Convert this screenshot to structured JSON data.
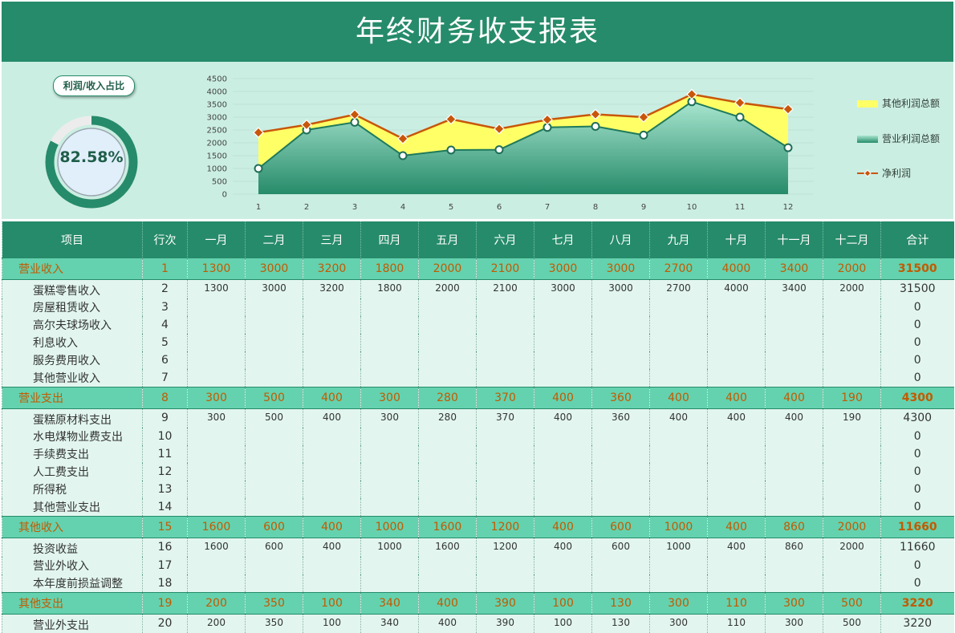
{
  "page": {
    "title": "年终财务收支报表"
  },
  "kpi": {
    "label": "利润/收入占比",
    "value": "82.58%",
    "ratio": 0.8258,
    "ring_color": "#268b6a"
  },
  "chart_data": {
    "type": "area",
    "x": [
      1,
      2,
      3,
      4,
      5,
      6,
      7,
      8,
      9,
      10,
      11,
      12
    ],
    "ylim": [
      0,
      4500
    ],
    "yticks": [
      0,
      500,
      1000,
      1500,
      2000,
      2500,
      3000,
      3500,
      4000,
      4500
    ],
    "grid": true,
    "legend_position": "right",
    "series": [
      {
        "name": "其他利润总额",
        "kind": "area",
        "color": "#ffff66",
        "values": [
          1400,
          200,
          300,
          660,
          1200,
          810,
          300,
          470,
          700,
          290,
          560,
          1500
        ]
      },
      {
        "name": "营业利润总额",
        "kind": "area",
        "color": "#3fae86",
        "values": [
          1000,
          2500,
          2800,
          1500,
          1720,
          1730,
          2600,
          2640,
          2300,
          3600,
          3000,
          1810
        ]
      },
      {
        "name": "净利润",
        "kind": "line",
        "color": "#c8560a",
        "values": [
          2400,
          2700,
          3100,
          2160,
          2920,
          2540,
          2900,
          3110,
          3000,
          3890,
          3560,
          3310
        ]
      }
    ]
  },
  "table": {
    "headers": [
      "项目",
      "行次",
      "一月",
      "二月",
      "三月",
      "四月",
      "五月",
      "六月",
      "七月",
      "八月",
      "九月",
      "十月",
      "十一月",
      "十二月",
      "合计"
    ],
    "groups": [
      {
        "label": "营业收入",
        "row": "1",
        "values": [
          "1300",
          "3000",
          "3200",
          "1800",
          "2000",
          "2100",
          "3000",
          "3000",
          "2700",
          "4000",
          "3400",
          "2000"
        ],
        "total": "31500",
        "items": [
          {
            "label": "蛋糕零售收入",
            "row": "2",
            "values": [
              "1300",
              "3000",
              "3200",
              "1800",
              "2000",
              "2100",
              "3000",
              "3000",
              "2700",
              "4000",
              "3400",
              "2000"
            ],
            "total": "31500"
          },
          {
            "label": "房屋租赁收入",
            "row": "3",
            "values": [],
            "total": "0"
          },
          {
            "label": "高尔夫球场收入",
            "row": "4",
            "values": [],
            "total": "0"
          },
          {
            "label": "利息收入",
            "row": "5",
            "values": [],
            "total": "0"
          },
          {
            "label": "服务费用收入",
            "row": "6",
            "values": [],
            "total": "0"
          },
          {
            "label": "其他营业收入",
            "row": "7",
            "values": [],
            "total": "0"
          }
        ]
      },
      {
        "label": "营业支出",
        "row": "8",
        "values": [
          "300",
          "500",
          "400",
          "300",
          "280",
          "370",
          "400",
          "360",
          "400",
          "400",
          "400",
          "190"
        ],
        "total": "4300",
        "items": [
          {
            "label": "蛋糕原材料支出",
            "row": "9",
            "values": [
              "300",
              "500",
              "400",
              "300",
              "280",
              "370",
              "400",
              "360",
              "400",
              "400",
              "400",
              "190"
            ],
            "total": "4300"
          },
          {
            "label": "水电煤物业费支出",
            "row": "10",
            "values": [],
            "total": "0"
          },
          {
            "label": "手续费支出",
            "row": "11",
            "values": [],
            "total": "0"
          },
          {
            "label": "人工费支出",
            "row": "12",
            "values": [],
            "total": "0"
          },
          {
            "label": "所得税",
            "row": "13",
            "values": [],
            "total": "0"
          },
          {
            "label": "其他营业支出",
            "row": "14",
            "values": [],
            "total": "0"
          }
        ]
      },
      {
        "label": "其他收入",
        "row": "15",
        "values": [
          "1600",
          "600",
          "400",
          "1000",
          "1600",
          "1200",
          "400",
          "600",
          "1000",
          "400",
          "860",
          "2000"
        ],
        "total": "11660",
        "items": [
          {
            "label": "投资收益",
            "row": "16",
            "values": [
              "1600",
              "600",
              "400",
              "1000",
              "1600",
              "1200",
              "400",
              "600",
              "1000",
              "400",
              "860",
              "2000"
            ],
            "total": "11660"
          },
          {
            "label": "营业外收入",
            "row": "17",
            "values": [],
            "total": "0"
          },
          {
            "label": "本年度前损益调整",
            "row": "18",
            "values": [],
            "total": "0"
          }
        ]
      },
      {
        "label": "其他支出",
        "row": "19",
        "values": [
          "200",
          "350",
          "100",
          "340",
          "400",
          "390",
          "100",
          "130",
          "300",
          "110",
          "300",
          "500"
        ],
        "total": "3220",
        "items": [
          {
            "label": "营业外支出",
            "row": "20",
            "values": [
              "200",
              "350",
              "100",
              "340",
              "400",
              "390",
              "100",
              "130",
              "300",
              "110",
              "300",
              "500"
            ],
            "total": "3220"
          }
        ]
      }
    ]
  }
}
